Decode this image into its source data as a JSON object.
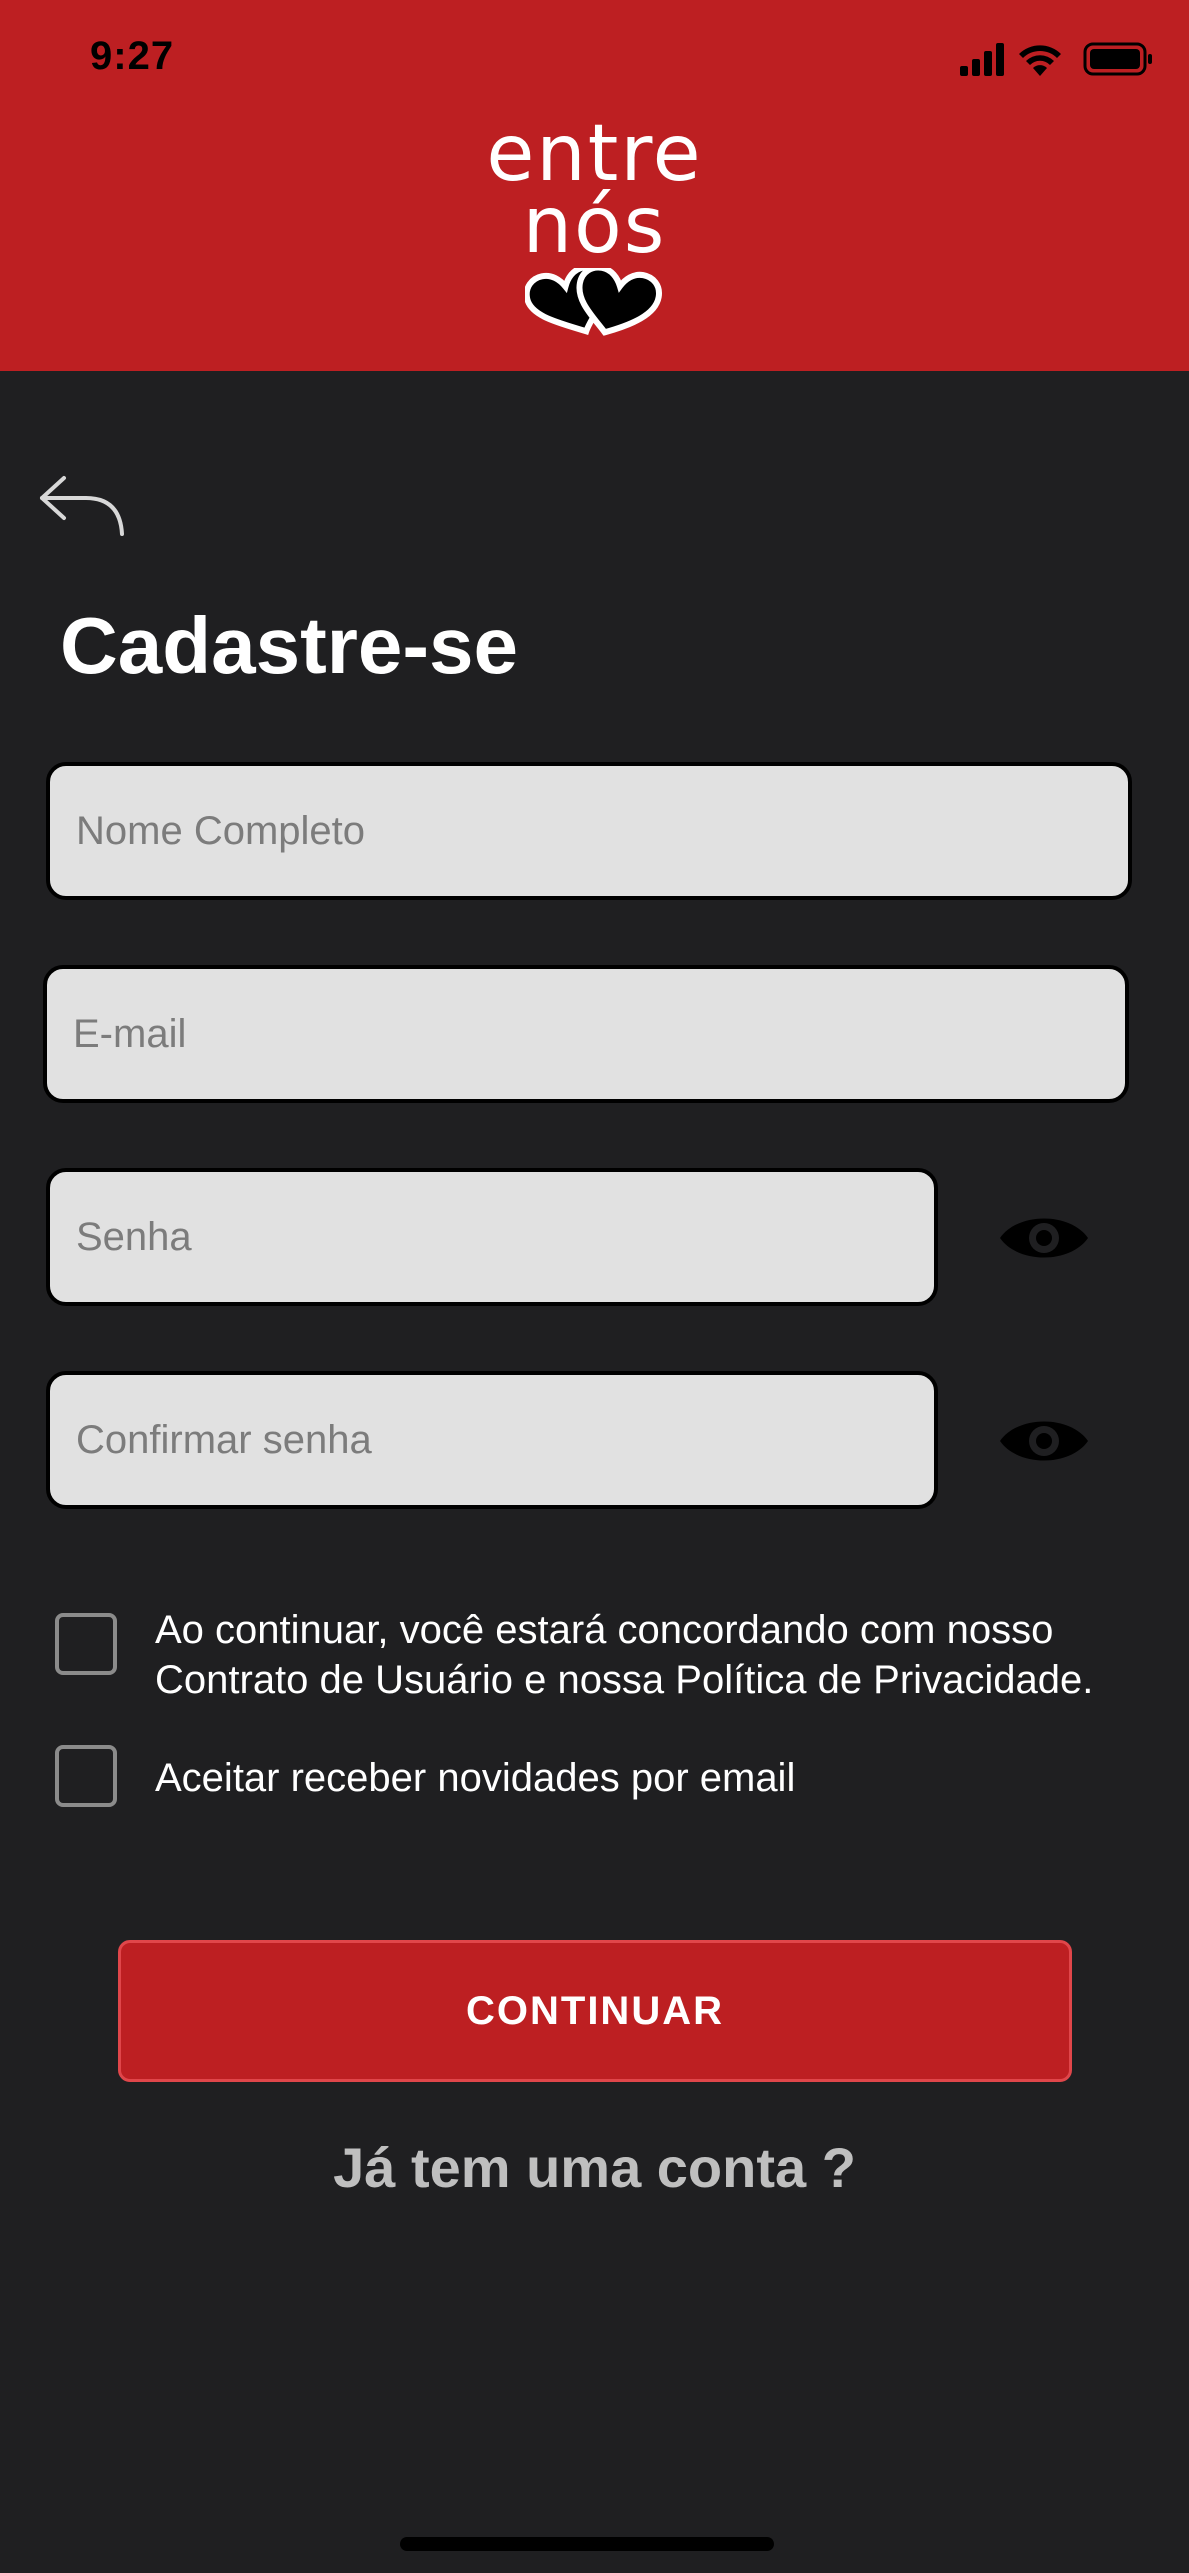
{
  "status_bar": {
    "time": "9:27"
  },
  "logo": {
    "line1": "entre",
    "line2": "nós"
  },
  "page": {
    "title": "Cadastre-se"
  },
  "form": {
    "full_name_placeholder": "Nome Completo",
    "email_placeholder": "E-mail",
    "password_placeholder": "Senha",
    "confirm_password_placeholder": "Confirmar senha"
  },
  "checkboxes": {
    "terms_line1": "Ao continuar, você estará concordando com nosso",
    "terms_line2": "Contrato de Usuário e nossa Política de Privacidade.",
    "newsletter": "Aceitar receber novidades por email"
  },
  "buttons": {
    "continue": "CONTINUAR",
    "login_link": "Já tem uma conta ?"
  },
  "colors": {
    "brand_red": "#bd1f22",
    "background": "#1f1f21",
    "field_bg": "#e1e1e1"
  }
}
